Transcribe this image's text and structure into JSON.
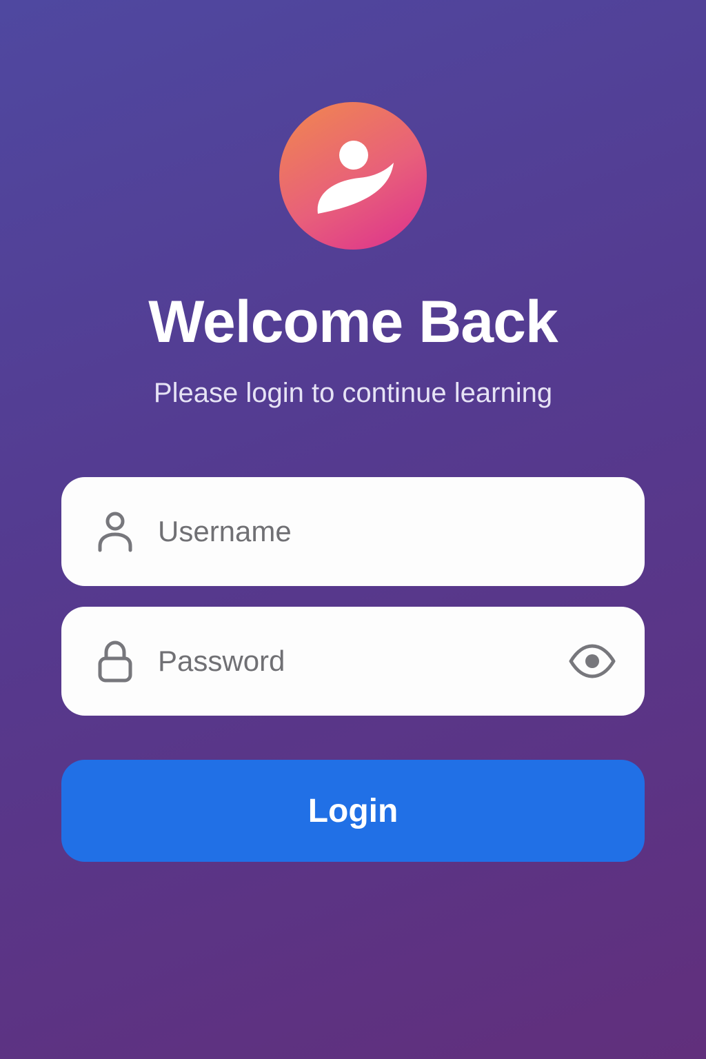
{
  "app": {
    "logo_icon": "person-learner-icon",
    "brand_gradient": [
      "#f0884e",
      "#dc2f8e"
    ]
  },
  "header": {
    "title": "Welcome Back",
    "subtitle": "Please login to continue learning"
  },
  "form": {
    "username": {
      "placeholder": "Username",
      "value": "",
      "icon": "user-icon"
    },
    "password": {
      "placeholder": "Password",
      "value": "",
      "icon": "lock-icon",
      "toggle_icon": "eye-icon"
    },
    "submit_label": "Login"
  },
  "colors": {
    "background_start": "#4f48a0",
    "background_end": "#612f7c",
    "button": "#2170e6",
    "field_bg": "#fdfdfd"
  }
}
